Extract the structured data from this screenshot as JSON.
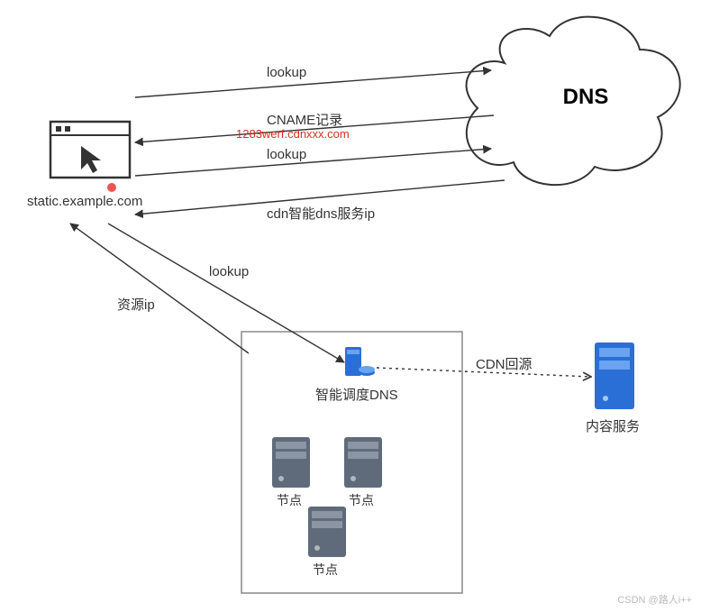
{
  "nodes": {
    "browser_caption": "static.example.com",
    "dns_cloud": "DNS",
    "smart_dns": "智能调度DNS",
    "content_server": "内容服务",
    "edge_node": "节点"
  },
  "edges": {
    "lookup1": "lookup",
    "cname_record": "CNAME记录",
    "cname_value": "1283werf.cdnxxx.com",
    "lookup2": "lookup",
    "cdn_dns_ip": "cdn智能dns服务ip",
    "lookup3": "lookup",
    "resource_ip": "资源ip",
    "cdn_origin": "CDN回源"
  },
  "watermark": "CSDN @路人i++"
}
